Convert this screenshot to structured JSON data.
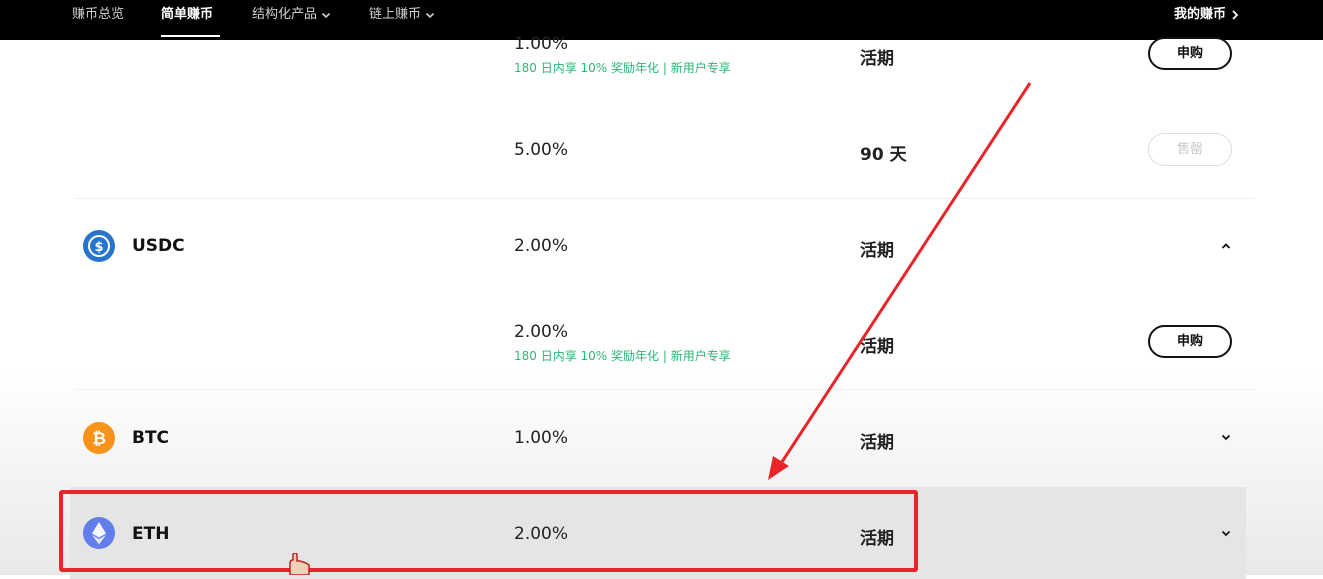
{
  "nav": {
    "items": [
      "赚币总览",
      "简单赚币",
      "结构化产品",
      "链上赚币"
    ],
    "my_earn": "我的赚币"
  },
  "rows": {
    "r1": {
      "rate": "1.00%",
      "promo": "180 日内享 10% 奖励年化 | 新用户专享",
      "term": "活期",
      "button": "申购"
    },
    "r2": {
      "rate": "5.00%",
      "term": "90 天",
      "button": "售罄"
    },
    "usdc": {
      "name": "USDC",
      "rate": "2.00%",
      "term": "活期"
    },
    "usdc_sub": {
      "rate": "2.00%",
      "promo": "180 日内享 10% 奖励年化 | 新用户专享",
      "term": "活期",
      "button": "申购"
    },
    "btc": {
      "name": "BTC",
      "rate": "1.00%",
      "term": "活期"
    },
    "eth": {
      "name": "ETH",
      "rate": "2.00%",
      "term": "活期"
    }
  },
  "colors": {
    "promo_green": "#2bb673",
    "usdc_blue": "#2775ca",
    "btc_orange": "#f7931a",
    "eth_blue": "#627eea",
    "annotation_red": "#e8262a"
  },
  "icons": [
    "chevron-down-icon",
    "chevron-up-icon",
    "chevron-right-icon",
    "usdc-icon",
    "btc-icon",
    "eth-icon",
    "hand-cursor-icon"
  ]
}
